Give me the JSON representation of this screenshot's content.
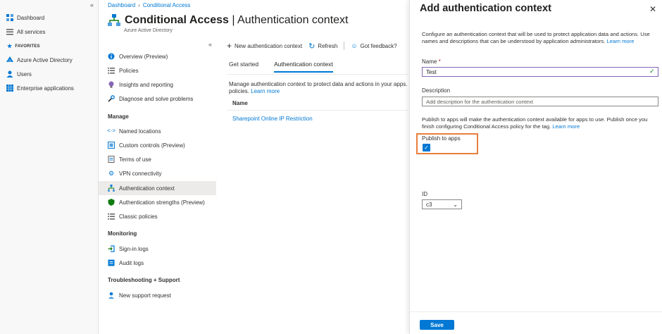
{
  "leftnav": {
    "items": [
      {
        "label": "Dashboard",
        "icon": "dashboard-icon"
      },
      {
        "label": "All services",
        "icon": "list-icon"
      }
    ],
    "favorites_label": "FAVORITES",
    "favorites": [
      {
        "label": "Azure Active Directory",
        "icon": "aad-icon"
      },
      {
        "label": "Users",
        "icon": "user-icon"
      },
      {
        "label": "Enterprise applications",
        "icon": "apps-grid-icon"
      }
    ]
  },
  "breadcrumb": [
    "Dashboard",
    "Conditional Access"
  ],
  "header": {
    "title_bold": "Conditional Access",
    "title_rest": " | Authentication context",
    "subtitle": "Azure Active Directory"
  },
  "blade_nav": {
    "items": [
      {
        "label": "Overview (Preview)",
        "icon": "info-icon"
      },
      {
        "label": "Policies",
        "icon": "list-icon"
      },
      {
        "label": "Insights and reporting",
        "icon": "lightbulb-icon"
      },
      {
        "label": "Diagnose and solve problems",
        "icon": "wrench-icon"
      }
    ],
    "manage_heading": "Manage",
    "manage_items": [
      {
        "label": "Named locations",
        "icon": "code-icon"
      },
      {
        "label": "Custom controls (Preview)",
        "icon": "controls-icon"
      },
      {
        "label": "Terms of use",
        "icon": "checklist-icon"
      },
      {
        "label": "VPN connectivity",
        "icon": "gear-icon"
      },
      {
        "label": "Authentication context",
        "icon": "network-icon"
      },
      {
        "label": "Authentication strengths (Preview)",
        "icon": "shield-icon"
      },
      {
        "label": "Classic policies",
        "icon": "list-icon"
      }
    ],
    "monitoring_heading": "Monitoring",
    "monitoring_items": [
      {
        "label": "Sign-in logs",
        "icon": "signin-icon"
      },
      {
        "label": "Audit logs",
        "icon": "audit-icon"
      }
    ],
    "support_heading": "Troubleshooting + Support",
    "support_items": [
      {
        "label": "New support request",
        "icon": "person-support-icon"
      }
    ]
  },
  "toolbar": {
    "new_label": "New authentication context",
    "refresh_label": "Refresh",
    "feedback_label": "Got feedback?"
  },
  "tabs": [
    {
      "label": "Get started",
      "active": false
    },
    {
      "label": "Authentication context",
      "active": true
    }
  ],
  "content": {
    "description_line1": "Manage authentication context to protect data and actions in your apps.",
    "description_line2": "policies.",
    "learn_more": "Learn more",
    "table": {
      "column_name": "Name",
      "rows": [
        "Sharepoint Online IP Restriction"
      ]
    }
  },
  "panel": {
    "title": "Add authentication context",
    "intro": "Configure an authentication context that will be used to protect application data and actions. Use names and descriptions that can be understood by application administrators.",
    "learn_more": "Learn more",
    "name_label": "Name",
    "name_required": "*",
    "name_value": "Test",
    "description_label": "Description",
    "description_placeholder": "Add description for the authentication context",
    "publish_text": "Publish to apps will make the authentication context available for apps to use. Publish once you finish configuring Conditional Access policy for the tag.",
    "publish_learn_more": "Learn more",
    "publish_label": "Publish to apps",
    "id_label": "ID",
    "id_value": "c3",
    "save_label": "Save"
  },
  "colors": {
    "accent": "#0078d4",
    "highlight": "#e87f3c",
    "valid": "#107c10"
  }
}
